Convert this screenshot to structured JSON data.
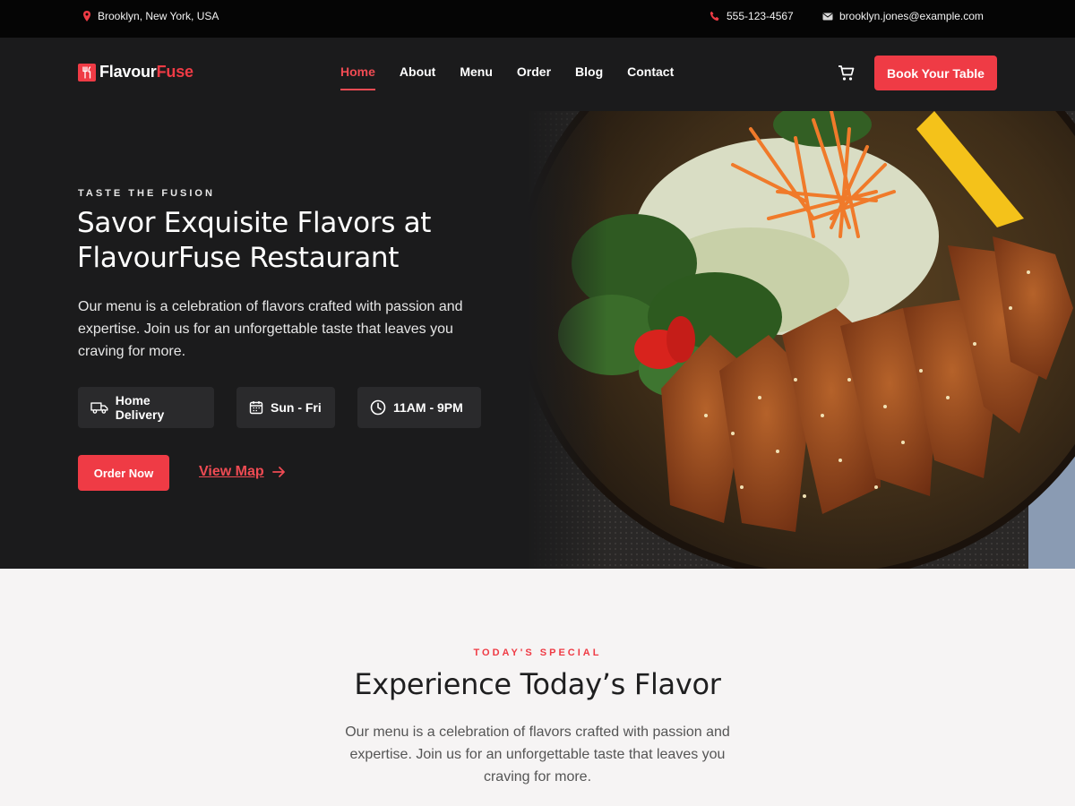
{
  "topbar": {
    "location": "Brooklyn, New York, USA",
    "phone": "555-123-4567",
    "email": "brooklyn.jones@example.com"
  },
  "brand": {
    "name_part1": "Flavour",
    "name_part2": "Fuse",
    "accent_color": "#ef3b45"
  },
  "nav": {
    "items": [
      {
        "label": "Home",
        "active": true
      },
      {
        "label": "About"
      },
      {
        "label": "Menu"
      },
      {
        "label": "Order"
      },
      {
        "label": "Blog"
      },
      {
        "label": "Contact"
      }
    ],
    "cart_icon": "cart-icon",
    "book_label": "Book Your Table"
  },
  "hero": {
    "kicker": "TASTE THE FUSION",
    "title": "Savor Exquisite Flavors at FlavourFuse Restaurant",
    "description": "Our menu is a celebration of flavors crafted with passion and expertise. Join us for an unforgettable taste that leaves you craving for more.",
    "chips": [
      {
        "label": "Home Delivery",
        "icon": "delivery-truck-icon"
      },
      {
        "label": "Sun - Fri",
        "icon": "calendar-icon"
      },
      {
        "label": "11AM - 9PM",
        "icon": "clock-icon"
      }
    ],
    "order_label": "Order Now",
    "map_label": "View Map"
  },
  "special": {
    "kicker": "TODAY'S SPECIAL",
    "title": "Experience Today’s Flavor",
    "description": "Our menu is a celebration of flavors crafted with passion and expertise. Join us for an unforgettable taste that leaves you craving for more."
  }
}
